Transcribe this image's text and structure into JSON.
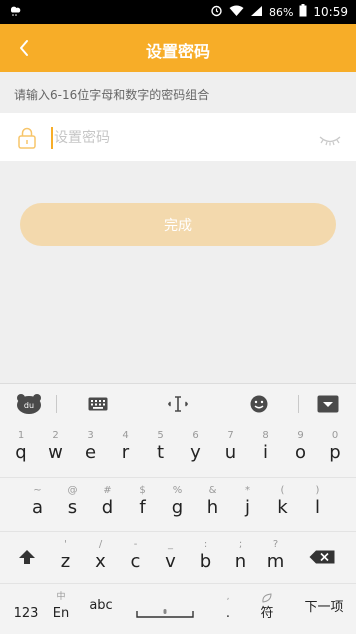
{
  "status_bar": {
    "battery": "86%",
    "time": "10:59"
  },
  "header": {
    "title": "设置密码"
  },
  "hint": "请输入6-16位字母和数字的密码组合",
  "password_field": {
    "placeholder": "设置密码",
    "value": ""
  },
  "submit_label": "完成",
  "colors": {
    "accent": "#f7ad28",
    "button_disabled": "#f3d9ad"
  },
  "keyboard": {
    "row1": [
      {
        "main": "q",
        "sub": "1"
      },
      {
        "main": "w",
        "sub": "2"
      },
      {
        "main": "e",
        "sub": "3"
      },
      {
        "main": "r",
        "sub": "4"
      },
      {
        "main": "t",
        "sub": "5"
      },
      {
        "main": "y",
        "sub": "6"
      },
      {
        "main": "u",
        "sub": "7"
      },
      {
        "main": "i",
        "sub": "8"
      },
      {
        "main": "o",
        "sub": "9"
      },
      {
        "main": "p",
        "sub": "0"
      }
    ],
    "row2": [
      {
        "main": "a",
        "sub": "~"
      },
      {
        "main": "s",
        "sub": "@"
      },
      {
        "main": "d",
        "sub": "#"
      },
      {
        "main": "f",
        "sub": "$"
      },
      {
        "main": "g",
        "sub": "%"
      },
      {
        "main": "h",
        "sub": "&"
      },
      {
        "main": "j",
        "sub": "*"
      },
      {
        "main": "k",
        "sub": "("
      },
      {
        "main": "l",
        "sub": ")"
      }
    ],
    "row3": [
      {
        "main": "z",
        "sub": "'"
      },
      {
        "main": "x",
        "sub": "/"
      },
      {
        "main": "c",
        "sub": "-"
      },
      {
        "main": "v",
        "sub": "_"
      },
      {
        "main": "b",
        "sub": ":"
      },
      {
        "main": "n",
        "sub": ";"
      },
      {
        "main": "m",
        "sub": "?"
      }
    ],
    "bottom": {
      "num": "123",
      "lang_main": "En",
      "lang_sub": "中",
      "abc": "abc",
      "comma": ",",
      "period": ".",
      "symbol": "符",
      "next": "下一项"
    }
  }
}
